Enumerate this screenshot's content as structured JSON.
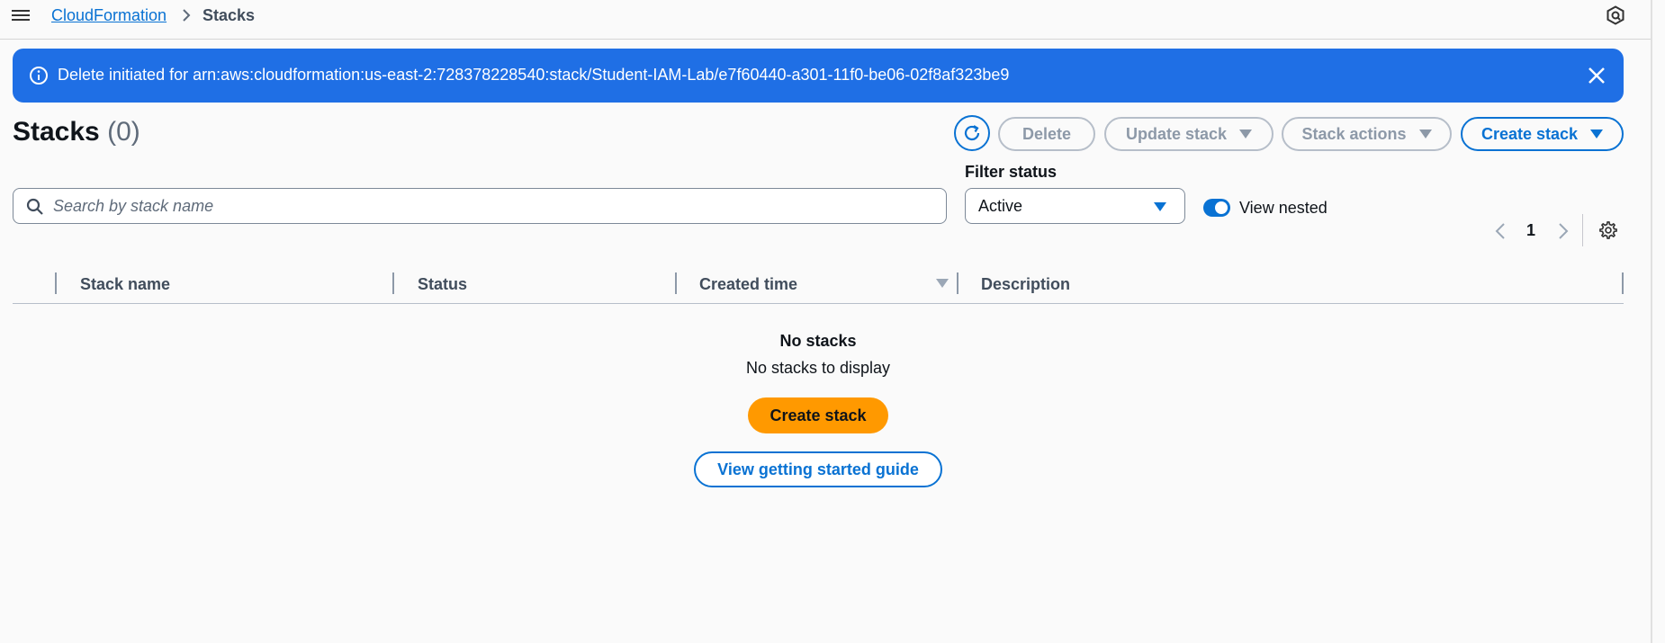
{
  "breadcrumb": {
    "service": "CloudFormation",
    "current": "Stacks"
  },
  "flash": {
    "message": "Delete initiated for arn:aws:cloudformation:us-east-2:728378228540:stack/Student-IAM-Lab/e7f60440-a301-11f0-be06-02f8af323be9",
    "color": "#1f6fe5"
  },
  "header": {
    "title": "Stacks",
    "count": "(0)"
  },
  "toolbar": {
    "delete_label": "Delete",
    "update_label": "Update stack",
    "actions_label": "Stack actions",
    "create_label": "Create stack"
  },
  "filters": {
    "search_placeholder": "Search by stack name",
    "status_label": "Filter status",
    "status_value": "Active",
    "view_nested_label": "View nested",
    "view_nested_on": true
  },
  "pagination": {
    "current_page": "1"
  },
  "table": {
    "columns": [
      "Stack name",
      "Status",
      "Created time",
      "Description"
    ],
    "rows": []
  },
  "empty_state": {
    "title": "No stacks",
    "subtitle": "No stacks to display",
    "create_label": "Create stack",
    "guide_label": "View getting started guide"
  },
  "colors": {
    "accent": "#0972d3",
    "primary_cta": "#ff9900"
  }
}
